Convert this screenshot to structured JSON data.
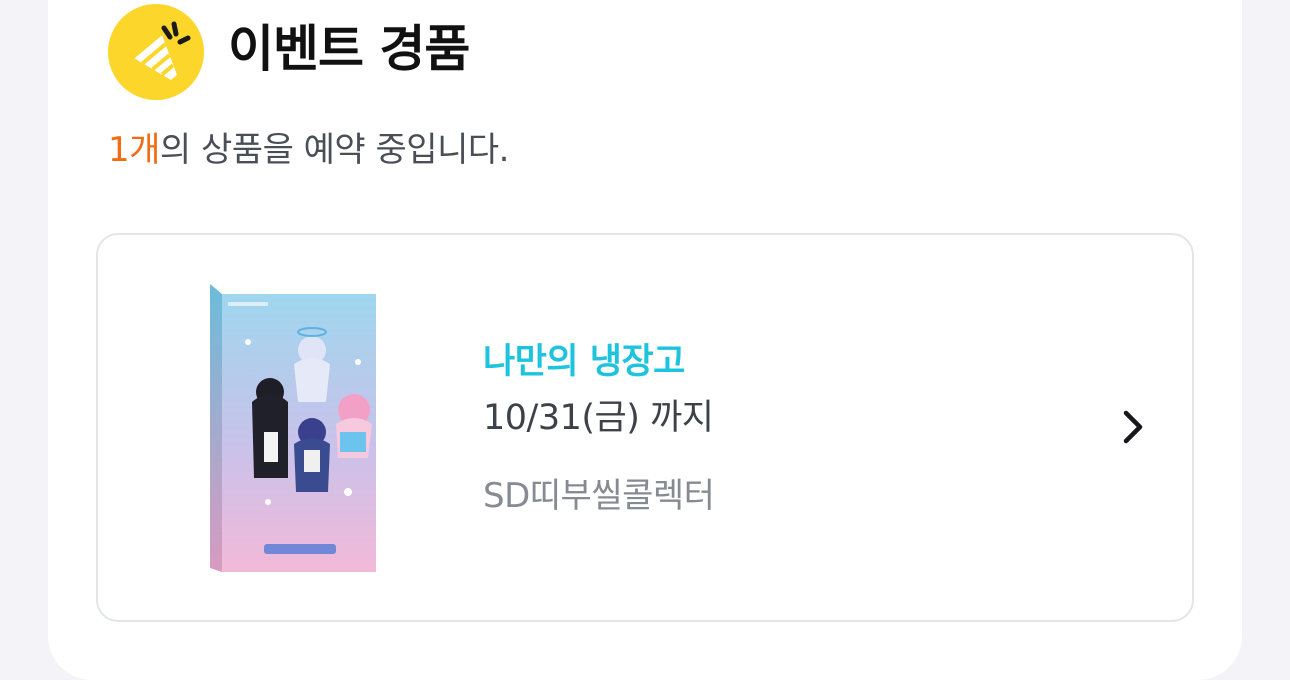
{
  "header": {
    "icon": "party-popper-icon",
    "title": "이벤트 경품"
  },
  "summary": {
    "count": "1개",
    "text": "의 상품을 예약 중입니다."
  },
  "item": {
    "name": "나만의 냉장고",
    "date": "10/31(금) 까지",
    "shop": "SD띠부씰콜렉터",
    "thumbnail": "product-box-image",
    "chevron": "chevron-right-icon"
  },
  "colors": {
    "accent_yellow": "#fcd62a",
    "count_orange": "#f36b12",
    "item_name_cyan": "#1ec3dd"
  }
}
